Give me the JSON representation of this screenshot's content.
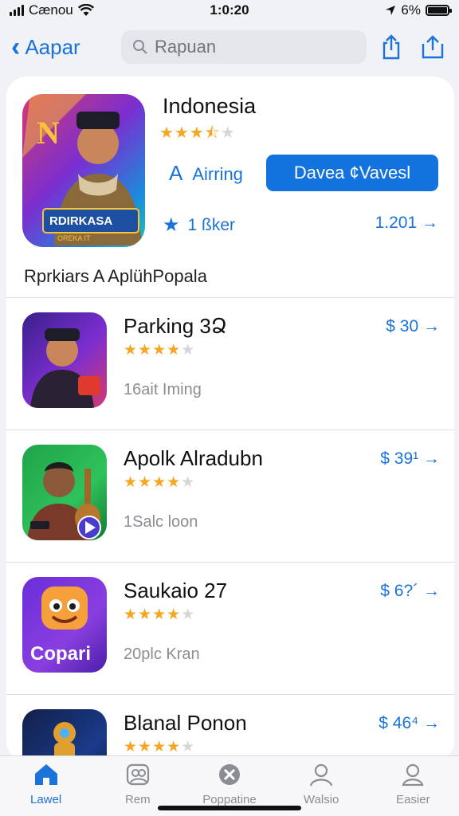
{
  "status": {
    "carrier": "Cænou",
    "time": "1:0:20",
    "battery": "6%"
  },
  "nav": {
    "back_label": "Aapar",
    "search_placeholder": "Rapuan"
  },
  "featured": {
    "title": "Indonesia",
    "rating_stars": 3.5,
    "rating_letter": "A",
    "rating_label": "Airring",
    "button_label": "Davea ¢Vavesl",
    "meta_label": "1 ßker",
    "count_label": "1.201 →",
    "icon_text_top": "N",
    "icon_text_banner": "RDIRKASA",
    "icon_text_sub": "OREKA IT"
  },
  "section_title": "Rprkiars A AplühPopala",
  "apps": [
    {
      "name": "Parking 3Ձ",
      "stars": 4,
      "sub": "16ait Iming",
      "price": "$ 30 →"
    },
    {
      "name": "Apolk Alradubn",
      "stars": 4,
      "sub": "1Salc loon",
      "price": "$ 39¹ →"
    },
    {
      "name": "Saukaio 27",
      "stars": 4,
      "sub": "20plc Kran",
      "price": "$ 6?´ →",
      "icon_label": "Copari"
    },
    {
      "name": "Blanal Ponon",
      "stars": 4,
      "sub": "",
      "price": "$ 46⁴ →"
    }
  ],
  "tabs": [
    {
      "label": "Lawel",
      "icon": "home-icon",
      "active": true
    },
    {
      "label": "Rem",
      "icon": "profiles-icon",
      "active": false
    },
    {
      "label": "Poppatine",
      "icon": "close-circle-icon",
      "active": false
    },
    {
      "label": "Walsio",
      "icon": "person-icon",
      "active": false
    },
    {
      "label": "Easier",
      "icon": "account-icon",
      "active": false
    }
  ],
  "colors": {
    "accent": "#1273de",
    "star": "#f5a623",
    "link": "#1a73d9"
  }
}
